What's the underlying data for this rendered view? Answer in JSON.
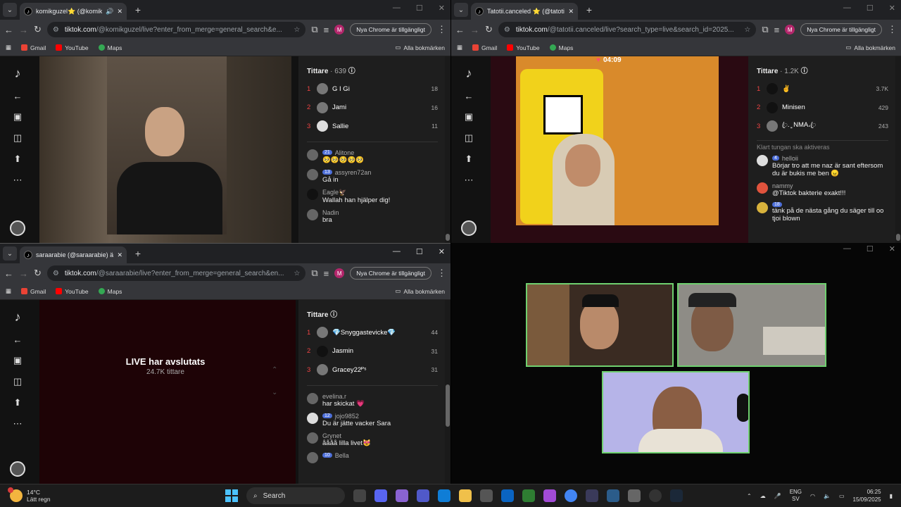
{
  "windows": {
    "top_left": {
      "tab_title": "komikguzel⭐ (@komikguz",
      "url_host": "tiktok.com",
      "url_path": "/@komikguzel/live?enter_from_merge=general_search&e...",
      "chrome_available": "Nya Chrome är tillgängligt",
      "viewers_title": "Tittare",
      "viewers_count": "· 639",
      "ranking": [
        {
          "rank": "1",
          "name": "G I Gi",
          "score": "18"
        },
        {
          "rank": "2",
          "name": "Jami",
          "score": "16"
        },
        {
          "rank": "3",
          "name": "Sallie",
          "score": "11"
        }
      ],
      "messages": [
        {
          "level": "21",
          "user": "Alitone",
          "text": "🥺🥺🥺🥺🥺"
        },
        {
          "level": "13",
          "user": "assyren72an",
          "text": "Gå in"
        },
        {
          "level": "",
          "user": "Eagle🦅",
          "text": "Wallah han hjälper dig!"
        },
        {
          "level": "",
          "user": "Nadin",
          "text": "bra"
        }
      ]
    },
    "top_right": {
      "tab_title": "Tatotii.canceled ⭐ (@tatotii.ca",
      "url_host": "tiktok.com",
      "url_path": "/@tatotii.canceled/live?search_type=live&search_id=2025...",
      "chrome_available": "Nya Chrome är tillgängligt",
      "timer": "04:09",
      "viewers_title": "Tittare",
      "viewers_count": "· 1.2K",
      "ranking": [
        {
          "rank": "1",
          "name": "✌",
          "score": "3.7K"
        },
        {
          "rank": "2",
          "name": "Minisen",
          "score": "429"
        },
        {
          "rank": "3",
          "name": "ꦿ.﮼NMA،ꦿ",
          "score": "243"
        }
      ],
      "system_msg": "Klart tungan ska aktiveras",
      "messages": [
        {
          "level": "4",
          "user": "helloii",
          "text": "Börjar tro att me naz är sant eftersom du är bukis me ben 😠"
        },
        {
          "level": "",
          "user": "nammy",
          "text": "@Tiktok bakterie exakt!!!"
        },
        {
          "level": "18",
          "user": "",
          "text": "tänk på de nästa gång du säger till oo tjoi blown"
        }
      ]
    },
    "bottom_left": {
      "tab_title": "saraarabie (@saraarabie) är",
      "url_host": "tiktok.com",
      "url_path": "/@saraarabie/live?enter_from_merge=general_search&en...",
      "chrome_available": "Nya Chrome är tillgängligt",
      "ended_title": "LIVE har avslutats",
      "ended_viewers": "24.7K tittare",
      "viewers_title": "Tittare",
      "ranking": [
        {
          "rank": "1",
          "name": "💎Snyggastevicke💎",
          "score": "44"
        },
        {
          "rank": "2",
          "name": "Jasmin",
          "score": "31"
        },
        {
          "rank": "3",
          "name": "Gracey22ᴾˢ",
          "score": "31"
        }
      ],
      "messages": [
        {
          "level": "",
          "user": "evelina.r",
          "text": "har skickat 💗"
        },
        {
          "level": "12",
          "user": "jojo9852",
          "text": "Du är jätte vacker Sara"
        },
        {
          "level": "",
          "user": "Grynet",
          "text": "åååå lilla livet😻"
        },
        {
          "level": "10",
          "user": "Bella",
          "text": ""
        }
      ]
    }
  },
  "bookmarks": [
    "Gmail",
    "YouTube",
    "Maps"
  ],
  "all_bookmarks": "Alla bokmärken",
  "taskbar": {
    "temp": "14°C",
    "weather": "Lätt regn",
    "search": "Search",
    "lang": "ENG",
    "region": "SV",
    "time": "06:25",
    "date": "15/09/2025"
  },
  "colors": {
    "rank": "#e44444",
    "level_badge": "#4c6ed8",
    "tile_border": "#6fd06f"
  }
}
